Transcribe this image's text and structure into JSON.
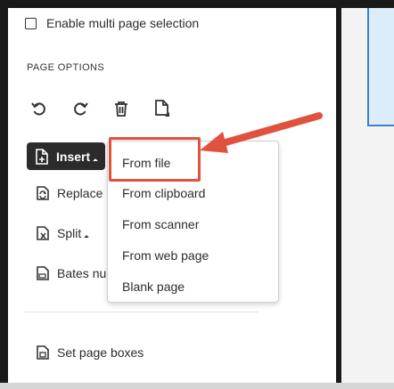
{
  "panel": {
    "checkbox_label": "Enable multi page selection",
    "section_title": "PAGE OPTIONS",
    "toolbar": [
      "undo-icon",
      "redo-icon",
      "delete-icon",
      "extract-page-icon"
    ],
    "items": {
      "insert": "Insert",
      "replace": "Replace",
      "split": "Split",
      "bates": "Bates nu",
      "set_page_boxes": "Set page boxes"
    }
  },
  "insert_menu": {
    "items": [
      "From file",
      "From clipboard",
      "From scanner",
      "From web page",
      "Blank page"
    ]
  },
  "colors": {
    "highlight": "#e0523e",
    "insert_button": "#2b2b2b",
    "page_preview_border": "#3f80c4"
  }
}
